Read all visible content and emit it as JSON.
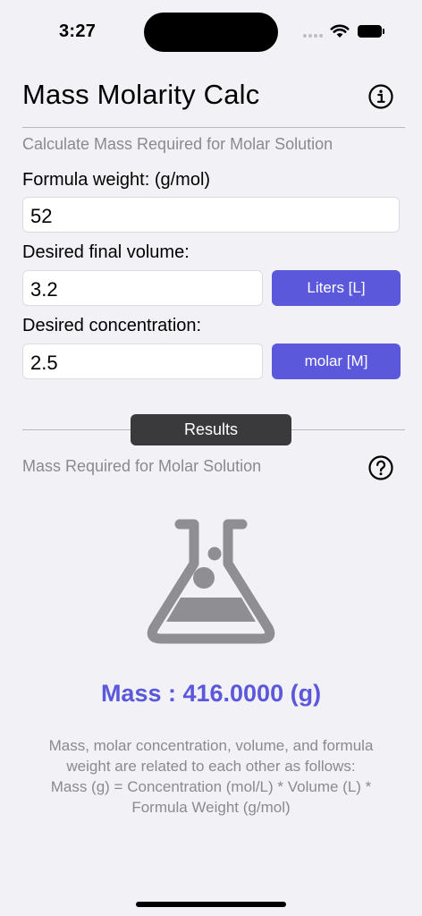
{
  "status_bar": {
    "time": "3:27"
  },
  "header": {
    "title": "Mass Molarity Calc",
    "info_icon": "info-circle-icon"
  },
  "calculator": {
    "subtitle": "Calculate Mass Required for Molar Solution",
    "formula_weight": {
      "label": "Formula weight:  (g/mol)",
      "value": "52"
    },
    "volume": {
      "label": "Desired final volume:",
      "value": "3.2",
      "unit": "Liters [L]"
    },
    "concentration": {
      "label": "Desired concentration:",
      "value": "2.5",
      "unit": "molar [M]"
    }
  },
  "results": {
    "tab_label": "Results",
    "subtitle": "Mass Required for Molar Solution",
    "help_icon": "question-circle-icon",
    "illustration_icon": "flask-icon",
    "mass_text": "Mass : 416.0000 (g)",
    "explanation_line1": "Mass, molar concentration, volume, and formula",
    "explanation_line2": "weight are related to each other as follows:",
    "explanation_line3": "Mass (g) = Concentration (mol/L) * Volume (L) *",
    "explanation_line4": "Formula Weight (g/mol)"
  },
  "colors": {
    "accent": "#5b58db",
    "background": "#f2f1f6",
    "pill": "#3a3a3c",
    "muted_text": "#8a8a8f"
  }
}
